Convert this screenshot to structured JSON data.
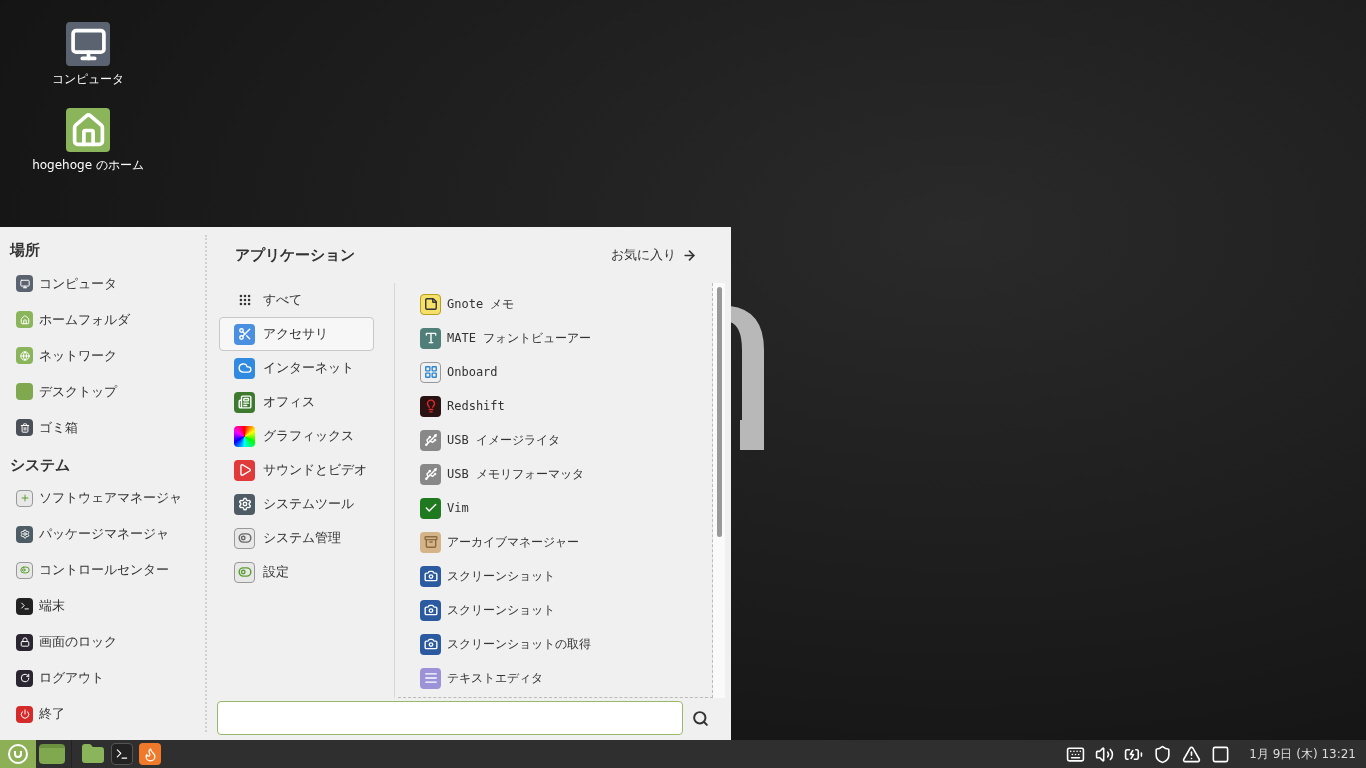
{
  "desktop": {
    "icons": [
      {
        "label": "コンピュータ",
        "kind": "monitor"
      },
      {
        "label": "hogehoge のホーム",
        "kind": "home-folder"
      }
    ]
  },
  "menu": {
    "places": {
      "title": "場所",
      "items": [
        {
          "label": "コンピュータ",
          "kind": "monitor"
        },
        {
          "label": "ホームフォルダ",
          "kind": "home-folder"
        },
        {
          "label": "ネットワーク",
          "kind": "network-folder"
        },
        {
          "label": "デスクトップ",
          "kind": "desktop"
        },
        {
          "label": "ゴミ箱",
          "kind": "trash"
        }
      ]
    },
    "system": {
      "title": "システム",
      "items": [
        {
          "label": "ソフトウェアマネージャ",
          "kind": "software"
        },
        {
          "label": "パッケージマネージャ",
          "kind": "gear"
        },
        {
          "label": "コントロールセンター",
          "kind": "toggles"
        },
        {
          "label": "端末",
          "kind": "terminal"
        },
        {
          "label": "画面のロック",
          "kind": "lock"
        },
        {
          "label": "ログアウト",
          "kind": "logout"
        },
        {
          "label": "終了",
          "kind": "power"
        }
      ]
    },
    "applications": {
      "title": "アプリケーション",
      "favorites_link": "お気に入り",
      "categories": [
        {
          "label": "すべて",
          "kind": "grid",
          "selected": false
        },
        {
          "label": "アクセサリ",
          "kind": "scissors",
          "selected": true
        },
        {
          "label": "インターネット",
          "kind": "cloud",
          "selected": false
        },
        {
          "label": "オフィス",
          "kind": "office",
          "selected": false
        },
        {
          "label": "グラフィックス",
          "kind": "rainbow",
          "selected": false
        },
        {
          "label": "サウンドとビデオ",
          "kind": "play",
          "selected": false
        },
        {
          "label": "システムツール",
          "kind": "gear",
          "selected": false
        },
        {
          "label": "システム管理",
          "kind": "toggles-grey",
          "selected": false
        },
        {
          "label": "設定",
          "kind": "toggles",
          "selected": false
        }
      ],
      "apps": [
        {
          "label": "Gnote メモ",
          "kind": "note"
        },
        {
          "label": "MATE フォントビューアー",
          "kind": "font"
        },
        {
          "label": "Onboard",
          "kind": "keyboard"
        },
        {
          "label": "Redshift",
          "kind": "bulb"
        },
        {
          "label": "USB イメージライタ",
          "kind": "usb"
        },
        {
          "label": "USB メモリフォーマッタ",
          "kind": "usb"
        },
        {
          "label": "Vim",
          "kind": "vim"
        },
        {
          "label": "アーカイブマネージャー",
          "kind": "archive"
        },
        {
          "label": "スクリーンショット",
          "kind": "camera"
        },
        {
          "label": "スクリーンショット",
          "kind": "camera"
        },
        {
          "label": "スクリーンショットの取得",
          "kind": "camera"
        },
        {
          "label": "テキストエディタ",
          "kind": "text"
        }
      ]
    }
  },
  "taskbar": {
    "launchers": [
      {
        "kind": "desktop"
      },
      {
        "kind": "folder"
      },
      {
        "kind": "terminal"
      },
      {
        "kind": "browser"
      }
    ],
    "tray": [
      {
        "kind": "keyboard"
      },
      {
        "kind": "volume"
      },
      {
        "kind": "battery"
      },
      {
        "kind": "shield"
      },
      {
        "kind": "warning"
      },
      {
        "kind": "window"
      }
    ],
    "clock": "1月 9日 (木) 13:21"
  }
}
